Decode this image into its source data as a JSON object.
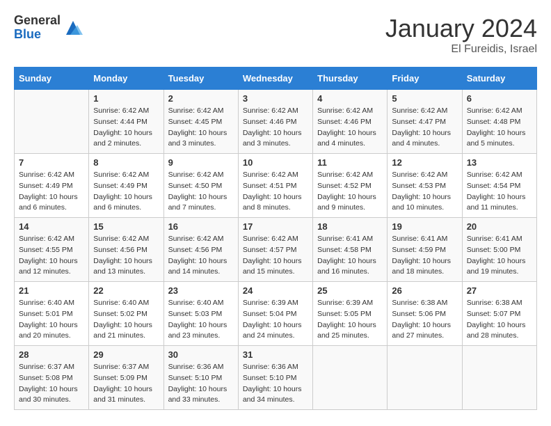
{
  "header": {
    "logo_general": "General",
    "logo_blue": "Blue",
    "month_title": "January 2024",
    "location": "El Fureidis, Israel"
  },
  "days_of_week": [
    "Sunday",
    "Monday",
    "Tuesday",
    "Wednesday",
    "Thursday",
    "Friday",
    "Saturday"
  ],
  "weeks": [
    [
      {
        "day": "",
        "info": ""
      },
      {
        "day": "1",
        "info": "Sunrise: 6:42 AM\nSunset: 4:44 PM\nDaylight: 10 hours\nand 2 minutes."
      },
      {
        "day": "2",
        "info": "Sunrise: 6:42 AM\nSunset: 4:45 PM\nDaylight: 10 hours\nand 3 minutes."
      },
      {
        "day": "3",
        "info": "Sunrise: 6:42 AM\nSunset: 4:46 PM\nDaylight: 10 hours\nand 3 minutes."
      },
      {
        "day": "4",
        "info": "Sunrise: 6:42 AM\nSunset: 4:46 PM\nDaylight: 10 hours\nand 4 minutes."
      },
      {
        "day": "5",
        "info": "Sunrise: 6:42 AM\nSunset: 4:47 PM\nDaylight: 10 hours\nand 4 minutes."
      },
      {
        "day": "6",
        "info": "Sunrise: 6:42 AM\nSunset: 4:48 PM\nDaylight: 10 hours\nand 5 minutes."
      }
    ],
    [
      {
        "day": "7",
        "info": "Sunrise: 6:42 AM\nSunset: 4:49 PM\nDaylight: 10 hours\nand 6 minutes."
      },
      {
        "day": "8",
        "info": "Sunrise: 6:42 AM\nSunset: 4:49 PM\nDaylight: 10 hours\nand 6 minutes."
      },
      {
        "day": "9",
        "info": "Sunrise: 6:42 AM\nSunset: 4:50 PM\nDaylight: 10 hours\nand 7 minutes."
      },
      {
        "day": "10",
        "info": "Sunrise: 6:42 AM\nSunset: 4:51 PM\nDaylight: 10 hours\nand 8 minutes."
      },
      {
        "day": "11",
        "info": "Sunrise: 6:42 AM\nSunset: 4:52 PM\nDaylight: 10 hours\nand 9 minutes."
      },
      {
        "day": "12",
        "info": "Sunrise: 6:42 AM\nSunset: 4:53 PM\nDaylight: 10 hours\nand 10 minutes."
      },
      {
        "day": "13",
        "info": "Sunrise: 6:42 AM\nSunset: 4:54 PM\nDaylight: 10 hours\nand 11 minutes."
      }
    ],
    [
      {
        "day": "14",
        "info": "Sunrise: 6:42 AM\nSunset: 4:55 PM\nDaylight: 10 hours\nand 12 minutes."
      },
      {
        "day": "15",
        "info": "Sunrise: 6:42 AM\nSunset: 4:56 PM\nDaylight: 10 hours\nand 13 minutes."
      },
      {
        "day": "16",
        "info": "Sunrise: 6:42 AM\nSunset: 4:56 PM\nDaylight: 10 hours\nand 14 minutes."
      },
      {
        "day": "17",
        "info": "Sunrise: 6:42 AM\nSunset: 4:57 PM\nDaylight: 10 hours\nand 15 minutes."
      },
      {
        "day": "18",
        "info": "Sunrise: 6:41 AM\nSunset: 4:58 PM\nDaylight: 10 hours\nand 16 minutes."
      },
      {
        "day": "19",
        "info": "Sunrise: 6:41 AM\nSunset: 4:59 PM\nDaylight: 10 hours\nand 18 minutes."
      },
      {
        "day": "20",
        "info": "Sunrise: 6:41 AM\nSunset: 5:00 PM\nDaylight: 10 hours\nand 19 minutes."
      }
    ],
    [
      {
        "day": "21",
        "info": "Sunrise: 6:40 AM\nSunset: 5:01 PM\nDaylight: 10 hours\nand 20 minutes."
      },
      {
        "day": "22",
        "info": "Sunrise: 6:40 AM\nSunset: 5:02 PM\nDaylight: 10 hours\nand 21 minutes."
      },
      {
        "day": "23",
        "info": "Sunrise: 6:40 AM\nSunset: 5:03 PM\nDaylight: 10 hours\nand 23 minutes."
      },
      {
        "day": "24",
        "info": "Sunrise: 6:39 AM\nSunset: 5:04 PM\nDaylight: 10 hours\nand 24 minutes."
      },
      {
        "day": "25",
        "info": "Sunrise: 6:39 AM\nSunset: 5:05 PM\nDaylight: 10 hours\nand 25 minutes."
      },
      {
        "day": "26",
        "info": "Sunrise: 6:38 AM\nSunset: 5:06 PM\nDaylight: 10 hours\nand 27 minutes."
      },
      {
        "day": "27",
        "info": "Sunrise: 6:38 AM\nSunset: 5:07 PM\nDaylight: 10 hours\nand 28 minutes."
      }
    ],
    [
      {
        "day": "28",
        "info": "Sunrise: 6:37 AM\nSunset: 5:08 PM\nDaylight: 10 hours\nand 30 minutes."
      },
      {
        "day": "29",
        "info": "Sunrise: 6:37 AM\nSunset: 5:09 PM\nDaylight: 10 hours\nand 31 minutes."
      },
      {
        "day": "30",
        "info": "Sunrise: 6:36 AM\nSunset: 5:10 PM\nDaylight: 10 hours\nand 33 minutes."
      },
      {
        "day": "31",
        "info": "Sunrise: 6:36 AM\nSunset: 5:10 PM\nDaylight: 10 hours\nand 34 minutes."
      },
      {
        "day": "",
        "info": ""
      },
      {
        "day": "",
        "info": ""
      },
      {
        "day": "",
        "info": ""
      }
    ]
  ]
}
